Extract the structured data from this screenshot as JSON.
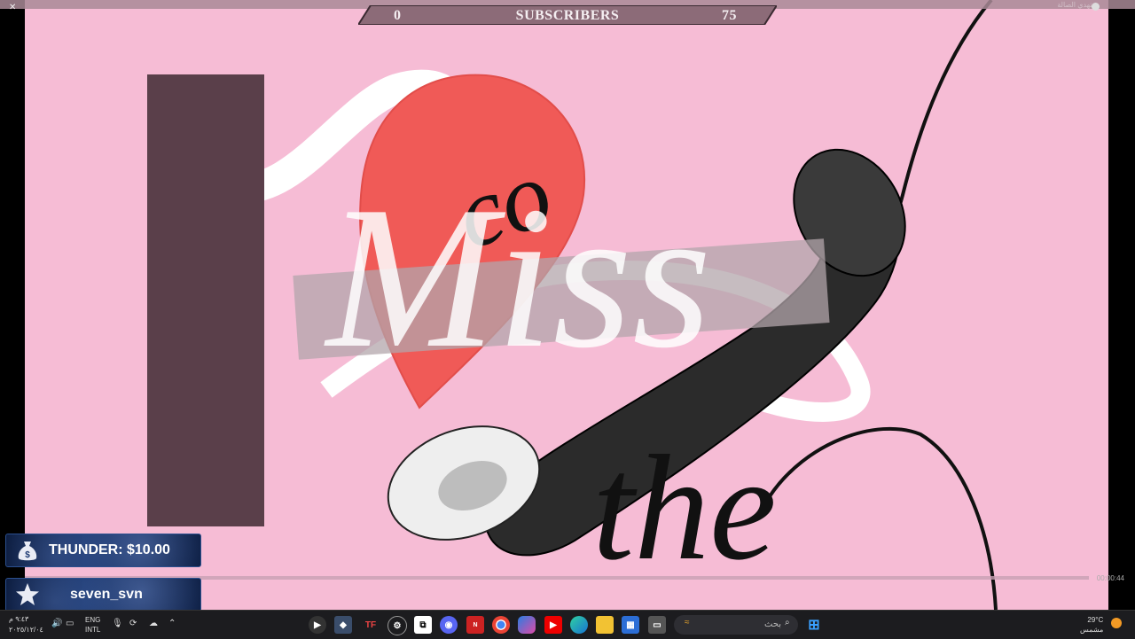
{
  "window": {
    "close_glyph": "✕",
    "title_right": "بتهدي الصالة"
  },
  "subscriber_goal": {
    "current": "0",
    "title": "SUBSCRIBERS",
    "goal": "75"
  },
  "artwork": {
    "letter_i": "I",
    "fragment_co": "co",
    "word_miss": "Miss",
    "word_the": "the"
  },
  "video": {
    "time": "00:00:44",
    "progress": 0.0
  },
  "alerts": {
    "donation": {
      "text": "THUNDER: $10.00",
      "icon": "money-bag-icon"
    },
    "follow": {
      "text": "seven_svn",
      "icon": "star-icon"
    }
  },
  "taskbar": {
    "clock_time": "٩:٤٣ م",
    "clock_date": "٢٠٢٥/١٢/٠٤",
    "lang_1": "ENG",
    "lang_2": "INTL",
    "search_placeholder": "بحث",
    "weather_temp": "29°C",
    "weather_desc": "مشمس",
    "apps": [
      "media-player",
      "browser-extension",
      "tf-app",
      "settings-app",
      "capcut-app",
      "discord-app",
      "news-app",
      "chrome-app",
      "copilot-app",
      "youtube-app",
      "edge-app",
      "file-explorer-app",
      "store-app",
      "terminal-app"
    ],
    "colors": {
      "accent": "#f6bcd5",
      "alert_blue": "#1d3a72"
    }
  }
}
